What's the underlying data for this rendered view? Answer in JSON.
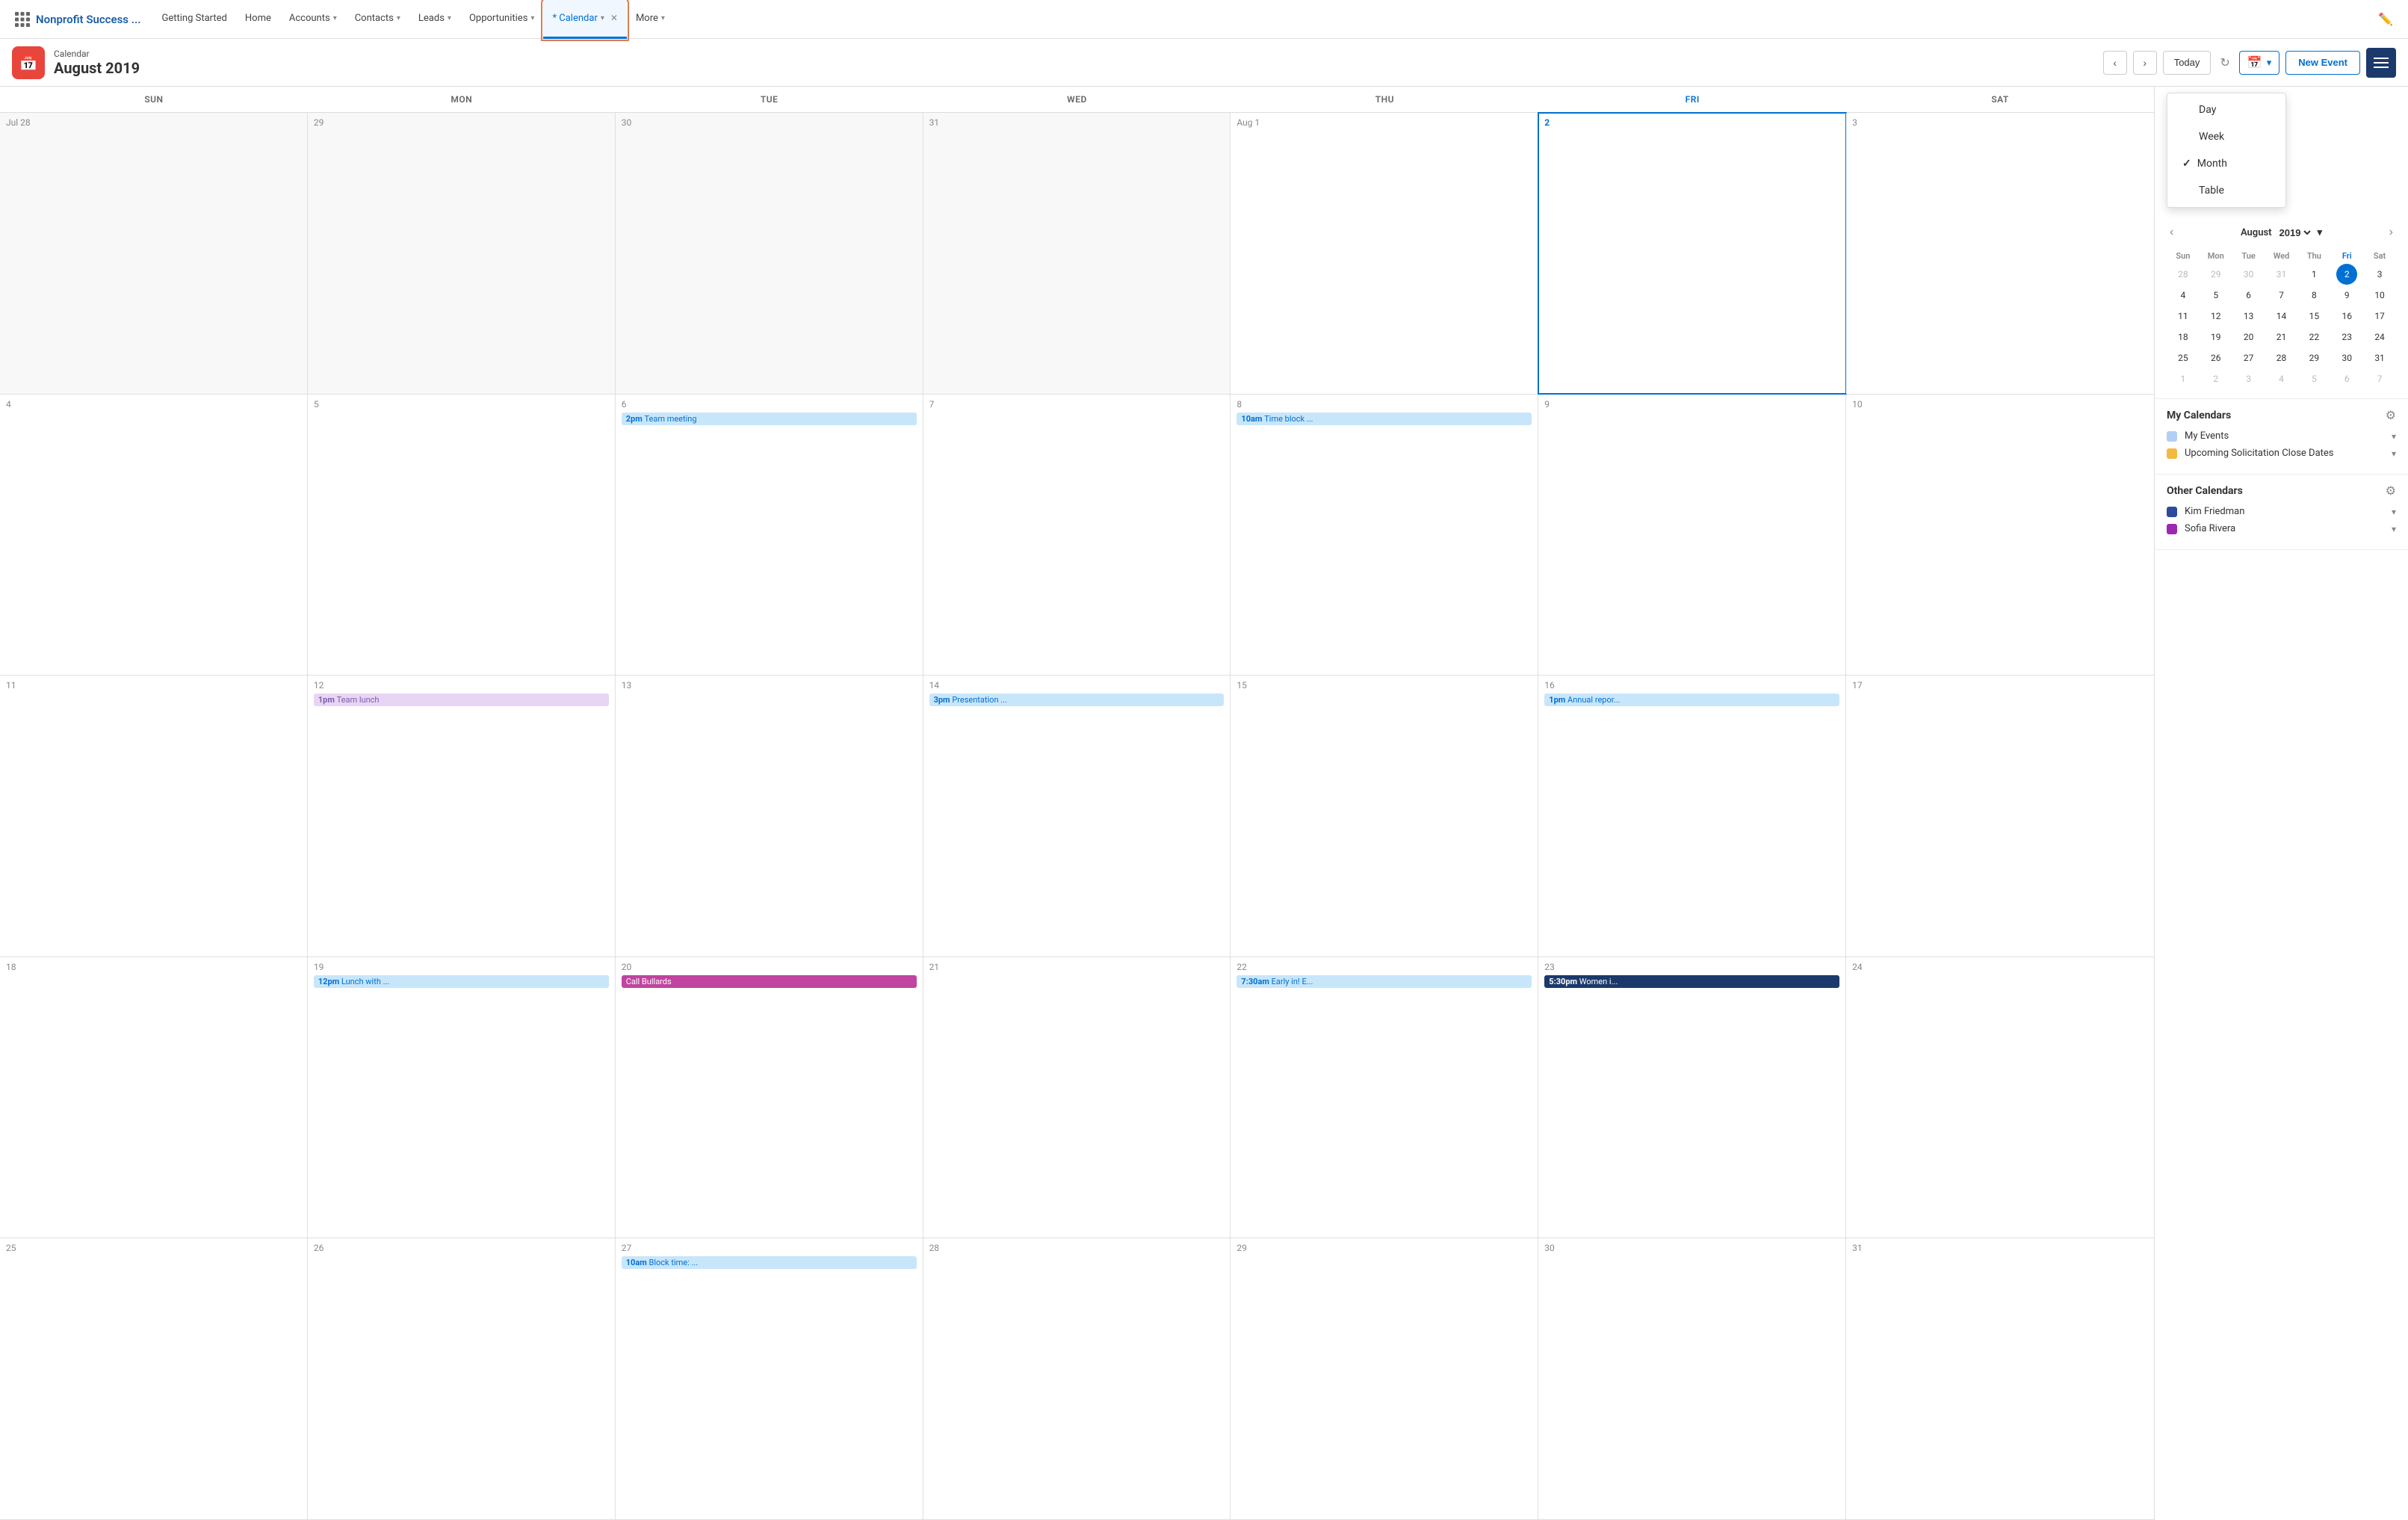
{
  "nav": {
    "brand": "Nonprofit Success ...",
    "items": [
      {
        "label": "Getting Started",
        "hasChevron": false,
        "active": false
      },
      {
        "label": "Home",
        "hasChevron": false,
        "active": false
      },
      {
        "label": "Accounts",
        "hasChevron": true,
        "active": false
      },
      {
        "label": "Contacts",
        "hasChevron": true,
        "active": false
      },
      {
        "label": "Leads",
        "hasChevron": true,
        "active": false
      },
      {
        "label": "Opportunities",
        "hasChevron": true,
        "active": false
      },
      {
        "label": "* Calendar",
        "hasChevron": true,
        "active": true,
        "hasClose": true
      },
      {
        "label": "More",
        "hasChevron": true,
        "active": false
      }
    ]
  },
  "header": {
    "calendarLabel": "Calendar",
    "monthYear": "August 2019",
    "todayBtn": "Today",
    "newEventBtn": "New Event"
  },
  "viewDropdown": {
    "items": [
      {
        "label": "Day",
        "checked": false
      },
      {
        "label": "Week",
        "checked": false
      },
      {
        "label": "Month",
        "checked": true
      },
      {
        "label": "Table",
        "checked": false
      }
    ]
  },
  "daysOfWeek": [
    "SUN",
    "MON",
    "TUE",
    "WED",
    "THU",
    "FRI",
    "SAT"
  ],
  "weeks": [
    {
      "days": [
        {
          "date": "Jul 28",
          "otherMonth": true,
          "events": []
        },
        {
          "date": "29",
          "otherMonth": true,
          "events": []
        },
        {
          "date": "30",
          "otherMonth": true,
          "events": []
        },
        {
          "date": "31",
          "otherMonth": true,
          "events": []
        },
        {
          "date": "Aug 1",
          "otherMonth": false,
          "events": []
        },
        {
          "date": "2",
          "otherMonth": false,
          "isToday": true,
          "events": []
        },
        {
          "date": "3",
          "otherMonth": false,
          "events": []
        }
      ]
    },
    {
      "days": [
        {
          "date": "4",
          "events": []
        },
        {
          "date": "5",
          "events": []
        },
        {
          "date": "6",
          "events": [
            {
              "time": "2pm",
              "title": "Team meeting",
              "style": "evt-blue"
            }
          ]
        },
        {
          "date": "7",
          "events": []
        },
        {
          "date": "8",
          "events": [
            {
              "time": "10am",
              "title": "Time block ...",
              "style": "evt-blue"
            }
          ]
        },
        {
          "date": "9",
          "events": []
        },
        {
          "date": "10",
          "events": []
        }
      ]
    },
    {
      "days": [
        {
          "date": "11",
          "events": []
        },
        {
          "date": "12",
          "events": [
            {
              "time": "1pm",
              "title": "Team lunch",
              "style": "evt-purple"
            }
          ]
        },
        {
          "date": "13",
          "events": []
        },
        {
          "date": "14",
          "events": [
            {
              "time": "3pm",
              "title": "Presentation ...",
              "style": "evt-blue"
            }
          ]
        },
        {
          "date": "15",
          "events": []
        },
        {
          "date": "16",
          "events": [
            {
              "time": "1pm",
              "title": "Annual repor...",
              "style": "evt-blue"
            }
          ]
        },
        {
          "date": "17",
          "events": []
        }
      ]
    },
    {
      "days": [
        {
          "date": "18",
          "events": []
        },
        {
          "date": "19",
          "events": [
            {
              "time": "12pm",
              "title": "Lunch with ...",
              "style": "evt-blue"
            }
          ]
        },
        {
          "date": "20",
          "events": [
            {
              "time": "",
              "title": "Call Bullards",
              "style": "evt-magenta"
            }
          ]
        },
        {
          "date": "21",
          "events": []
        },
        {
          "date": "22",
          "events": [
            {
              "time": "7:30am",
              "title": "Early in! E...",
              "style": "evt-blue"
            }
          ]
        },
        {
          "date": "23",
          "events": [
            {
              "time": "5:30pm",
              "title": "Women i...",
              "style": "evt-dark-blue"
            }
          ]
        },
        {
          "date": "24",
          "events": []
        }
      ]
    },
    {
      "days": [
        {
          "date": "25",
          "events": []
        },
        {
          "date": "26",
          "events": []
        },
        {
          "date": "27",
          "events": [
            {
              "time": "10am",
              "title": "Block time: ...",
              "style": "evt-blue"
            }
          ]
        },
        {
          "date": "28",
          "events": []
        },
        {
          "date": "29",
          "events": []
        },
        {
          "date": "30",
          "events": []
        },
        {
          "date": "31",
          "events": []
        }
      ]
    }
  ],
  "miniCal": {
    "monthLabel": "August",
    "yearValue": "2019",
    "dows": [
      "Sun",
      "Mon",
      "Tue",
      "Thu",
      "Fri",
      "Sat"
    ],
    "dowsFull": [
      "Sun",
      "Mon",
      "Tue",
      "Wed",
      "Thu",
      "Fri",
      "Sat"
    ],
    "rows": [
      [
        "28",
        "29",
        "30",
        "31",
        "1",
        "2",
        "3"
      ],
      [
        "4",
        "5",
        "6",
        "7",
        "8",
        "9",
        "10"
      ],
      [
        "11",
        "12",
        "13",
        "14",
        "15",
        "16",
        "17"
      ],
      [
        "18",
        "19",
        "20",
        "21",
        "22",
        "23",
        "24"
      ],
      [
        "25",
        "26",
        "27",
        "28",
        "29",
        "30",
        "31"
      ],
      [
        "1",
        "2",
        "3",
        "4",
        "5",
        "6",
        "7"
      ]
    ],
    "otherRows": [
      [
        true,
        true,
        true,
        true,
        false,
        false,
        false
      ],
      [
        false,
        false,
        false,
        false,
        false,
        false,
        false
      ],
      [
        false,
        false,
        false,
        false,
        false,
        false,
        false
      ],
      [
        false,
        false,
        false,
        false,
        false,
        false,
        false
      ],
      [
        false,
        false,
        false,
        false,
        false,
        false,
        false
      ],
      [
        true,
        true,
        true,
        true,
        true,
        true,
        true
      ]
    ],
    "todayCell": "2",
    "todayRow": 0,
    "todayCol": 5
  },
  "myCalendars": {
    "title": "My Calendars",
    "items": [
      {
        "name": "My Events",
        "color": "#b0cff5"
      },
      {
        "name": "Upcoming Solicitation Close Dates",
        "color": "#f4b942"
      }
    ]
  },
  "otherCalendars": {
    "title": "Other Calendars",
    "items": [
      {
        "name": "Kim Friedman",
        "color": "#2e4a9e"
      },
      {
        "name": "Sofia Rivera",
        "color": "#9c27b0"
      }
    ]
  }
}
